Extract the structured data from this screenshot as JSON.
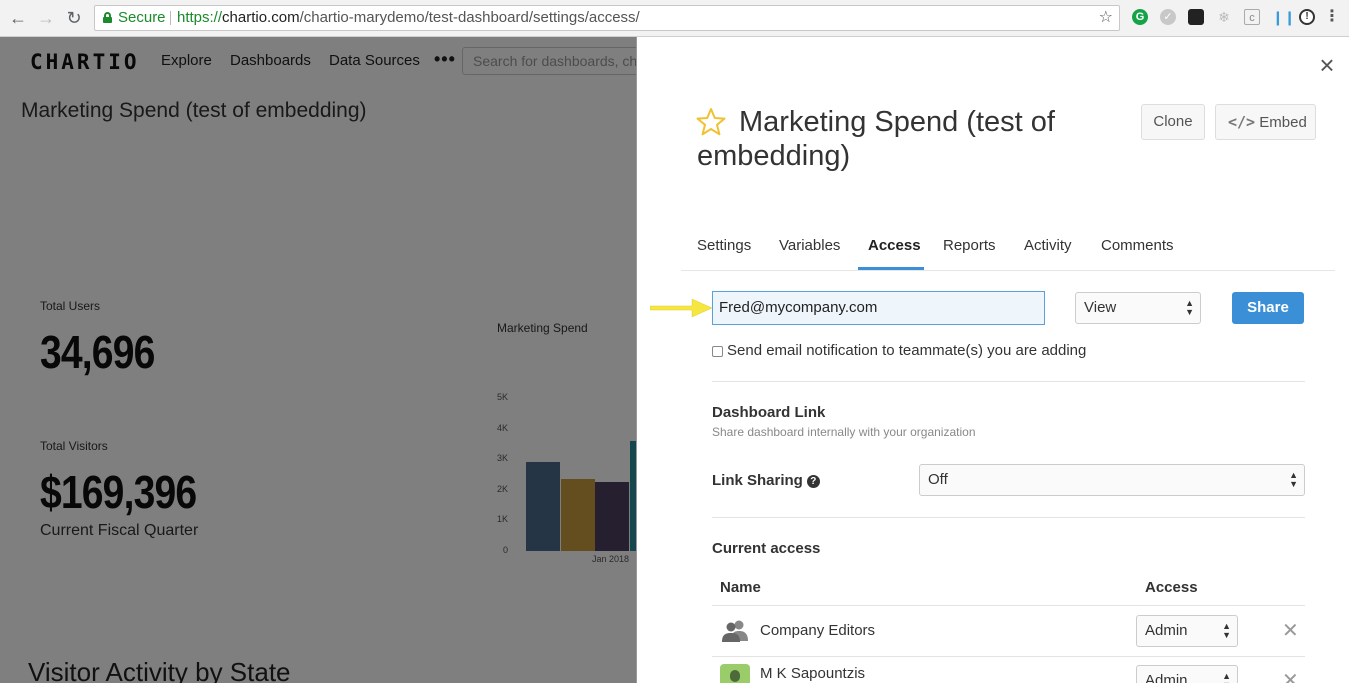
{
  "browser": {
    "secure_label": "Secure",
    "url_scheme": "https://",
    "url_host": "chartio.com",
    "url_path": "/chartio-marydemo/test-dashboard/settings/access/"
  },
  "app": {
    "logo": "CHARTIO",
    "nav": [
      "Explore",
      "Dashboards",
      "Data Sources"
    ],
    "more": "•••",
    "search_placeholder": "Search for dashboards, ch",
    "dashboard_title": "Marketing Spend (test of embedding)",
    "metrics": [
      {
        "label": "Total Users",
        "value": "34,696",
        "sub": ""
      },
      {
        "label": "Total Visitors",
        "value": "$169,396",
        "sub": "Current Fiscal Quarter"
      }
    ],
    "section_title": "Visitor Activity by State"
  },
  "chart_data": {
    "type": "bar",
    "title": "Marketing Spend",
    "categories": [
      "Jan 2018"
    ],
    "series": [
      {
        "values": [
          2900
        ],
        "color": "#4a6a8a"
      },
      {
        "values": [
          2350
        ],
        "color": "#c99a3e"
      },
      {
        "values": [
          2250
        ],
        "color": "#4a3f5e"
      },
      {
        "values": [
          3600
        ],
        "color": "#2a8f9a"
      }
    ],
    "yticks": [
      "5K",
      "4K",
      "3K",
      "2K",
      "1K",
      "0"
    ],
    "ylim": [
      0,
      5000
    ]
  },
  "panel": {
    "title": "Marketing Spend (test of embedding)",
    "clone_label": "Clone",
    "embed_label": "Embed",
    "tabs": [
      "Settings",
      "Variables",
      "Access",
      "Reports",
      "Activity",
      "Comments"
    ],
    "active_tab": "Access",
    "email_value": "Fred@mycompany.com",
    "permission_value": "View",
    "share_label": "Share",
    "notify_label": "Send email notification to teammate(s) you are adding",
    "dashboard_link_title": "Dashboard Link",
    "dashboard_link_sub": "Share dashboard internally with your organization",
    "link_sharing_label": "Link Sharing",
    "link_sharing_value": "Off",
    "current_access_title": "Current access",
    "col_name": "Name",
    "col_access": "Access",
    "rows": [
      {
        "name": "Company Editors",
        "access": "Admin"
      },
      {
        "name": "M K Sapountzis",
        "access": "Admin"
      }
    ],
    "remove_symbol": "✕"
  },
  "colors": {
    "accent": "#3a8fd6",
    "arrow": "#f5e642",
    "star": "#f0c232"
  }
}
